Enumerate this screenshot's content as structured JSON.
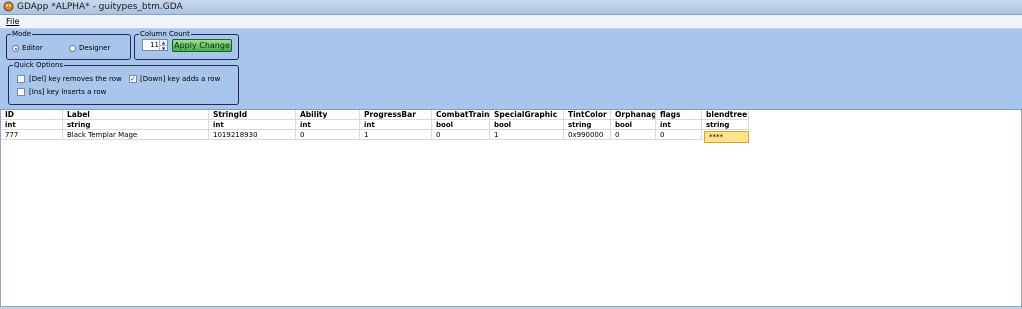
{
  "window": {
    "title": "GDApp *ALPHA* - guitypes_btm.GDA"
  },
  "menu": {
    "file": "File"
  },
  "mode": {
    "label": "Mode",
    "options": [
      "Editor",
      "Designer"
    ],
    "selected": "Editor"
  },
  "column_count": {
    "label": "Column Count",
    "value": "11",
    "apply_label": "Apply Change"
  },
  "quick_options": {
    "label": "Quick Options",
    "del_removes_row": {
      "label": "[Del] key removes the row",
      "checked": false
    },
    "down_adds_row": {
      "label": "[Down] key adds a row",
      "checked": true
    },
    "ins_inserts_row": {
      "label": "[Ins] key inserts a row",
      "checked": false
    }
  },
  "grid": {
    "columns": [
      "ID",
      "Label",
      "StringId",
      "Ability",
      "ProgressBar",
      "CombatTrain",
      "SpecialGraphic",
      "TintColor",
      "Orphanag",
      "flags",
      "blendtree"
    ],
    "types": [
      "int",
      "string",
      "int",
      "int",
      "int",
      "bool",
      "bool",
      "string",
      "bool",
      "int",
      "string"
    ],
    "rows": [
      [
        "777",
        "Black Templar Mage",
        "1019218930",
        "0",
        "1",
        "0",
        "1",
        "0x990000",
        "0",
        "0",
        "****"
      ]
    ],
    "selected_cell": "row 1, blendtree"
  },
  "colors": {
    "panel": "#a8c6eb",
    "apply_button": "#45b04a",
    "selected_cell": "#fde48c"
  }
}
